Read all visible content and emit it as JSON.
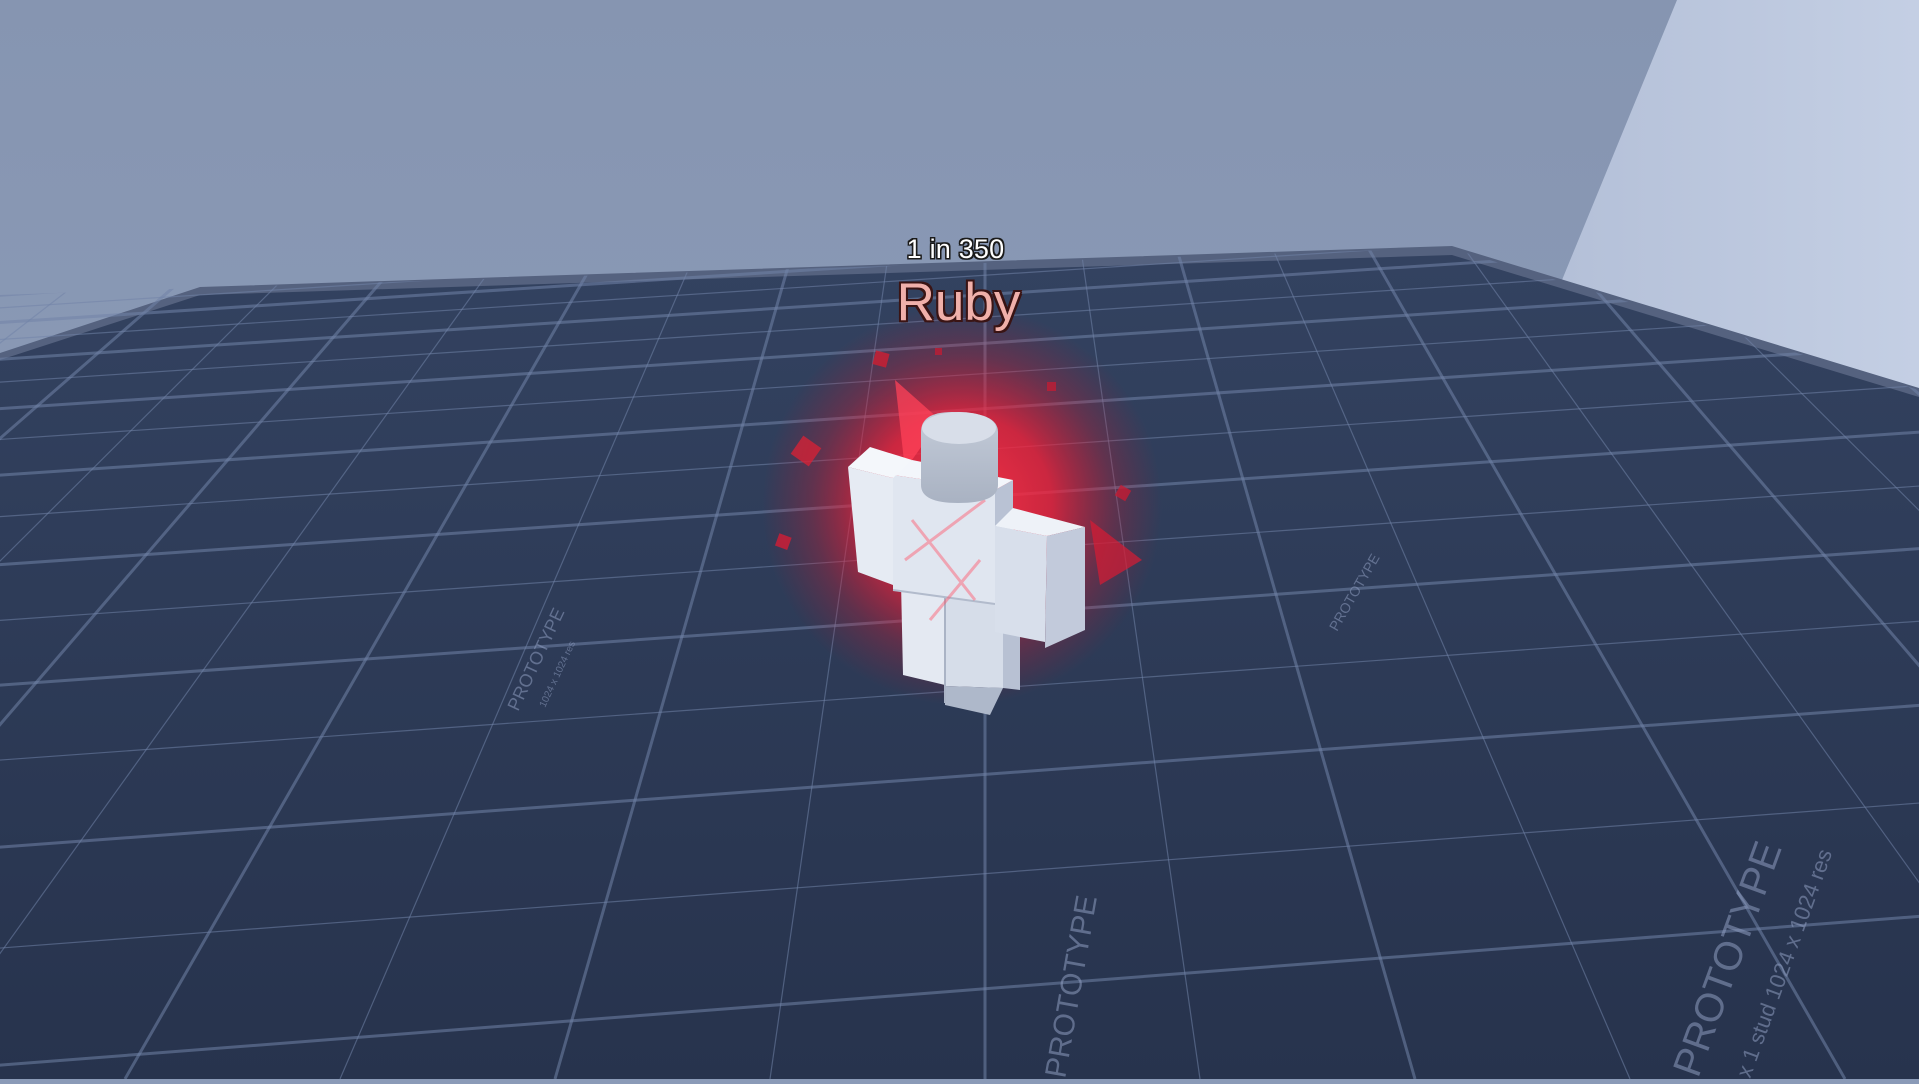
{
  "overhead": {
    "rarity": "1 in 350",
    "aura_name": "Ruby"
  },
  "floor_texture": {
    "label_large": "PROTOTYPE",
    "label_unit": "x 1 stud",
    "label_res": "1024 x 1024 res"
  },
  "colors": {
    "sky": "#8a9ab7",
    "floor": "#2c3a56",
    "grid": "#6f7fa3",
    "aura": "#ff2a3c",
    "aura_text": "#f0b0aa",
    "avatar": "#d2d9e6"
  },
  "icons": {
    "avatar": "blocky-avatar-icon"
  }
}
